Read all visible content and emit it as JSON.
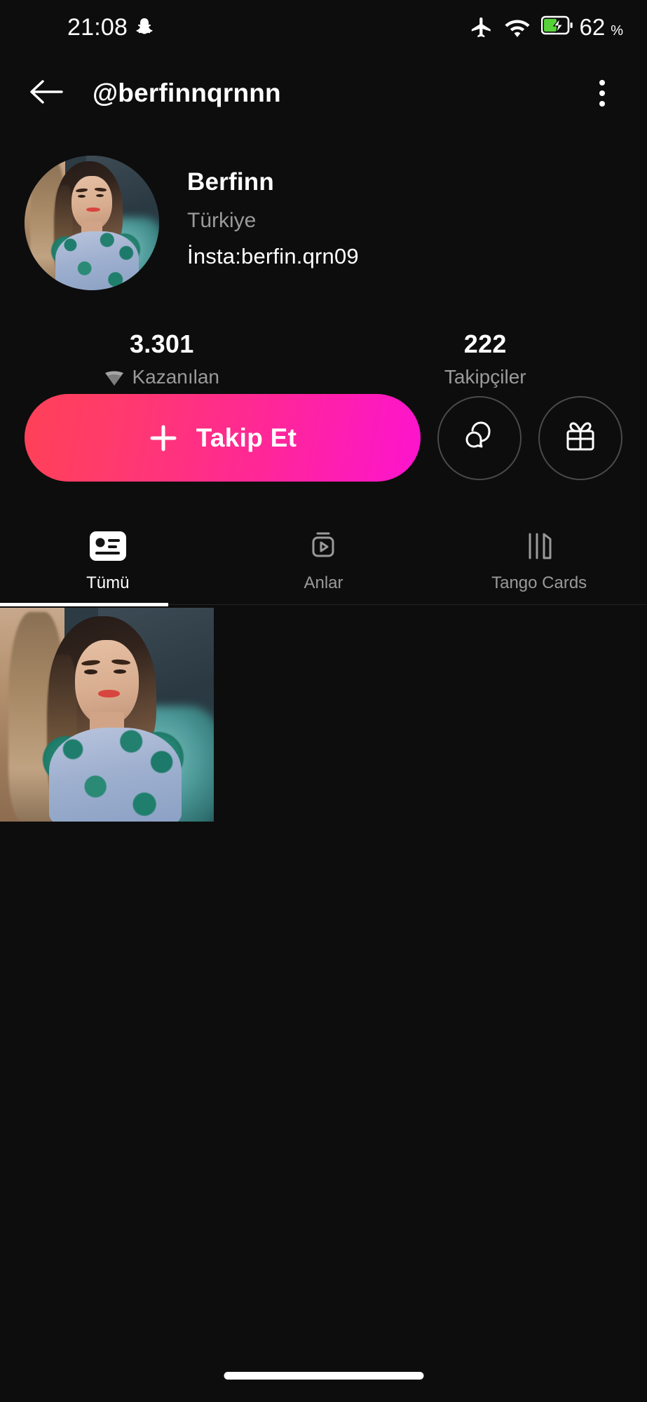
{
  "status_bar": {
    "time": "21:08",
    "icons": [
      "snapchat-ghost-icon",
      "airplane-mode-icon",
      "wifi-icon",
      "battery-charging-icon"
    ],
    "battery_percent": "62",
    "battery_symbol": "%"
  },
  "header": {
    "back_icon": "arrow-left-icon",
    "title": "@berfinnqrnnn",
    "more_icon": "more-vertical-icon"
  },
  "profile": {
    "avatar_alt": "Berfinn profile photo",
    "display_name": "Berfinn",
    "country": "Türkiye",
    "bio": "İnsta:berfin.qrn09"
  },
  "stats": [
    {
      "value": "3.301",
      "label": "Kazanılan",
      "icon": "diamond-icon"
    },
    {
      "value": "222",
      "label": "Takipçiler",
      "icon": ""
    }
  ],
  "actions": {
    "follow_label": "Takip Et",
    "follow_icon": "plus-icon",
    "message_icon": "chat-bubbles-icon",
    "gift_icon": "gift-icon",
    "gradient_start": "#ff4157",
    "gradient_end": "#fc14cf"
  },
  "tabs": [
    {
      "label": "Tümü",
      "icon": "profile-card-icon",
      "active": true
    },
    {
      "label": "Anlar",
      "icon": "video-moments-icon",
      "active": false
    },
    {
      "label": "Tango Cards",
      "icon": "cards-icon",
      "active": false
    }
  ],
  "content_grid": {
    "items": [
      {
        "alt": "Portrait photo of Berfinn in a teal floral dress"
      }
    ]
  },
  "system": {
    "gesture_bar": "home-indicator"
  }
}
